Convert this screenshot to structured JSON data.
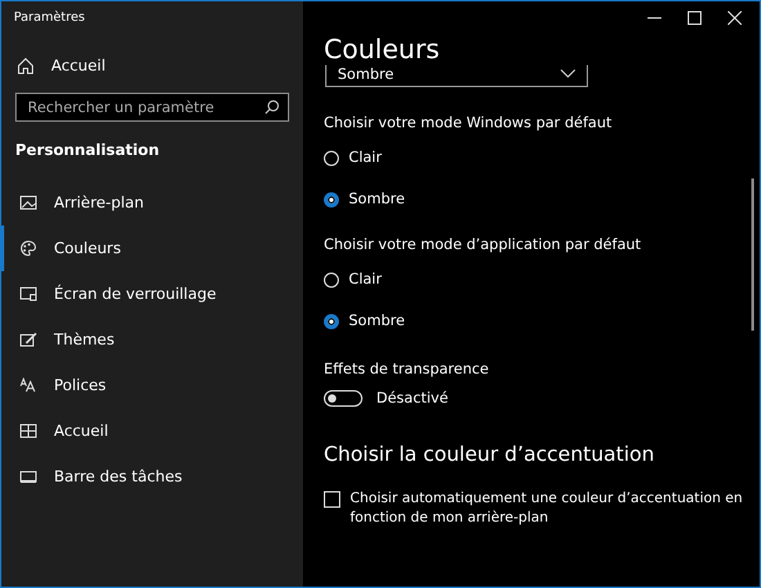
{
  "window": {
    "title": "Paramètres"
  },
  "sidebar": {
    "home": "Accueil",
    "search": {
      "placeholder": "Rechercher un paramètre"
    },
    "section": "Personnalisation",
    "items": [
      {
        "label": "Arrière-plan",
        "selected": false
      },
      {
        "label": "Couleurs",
        "selected": true
      },
      {
        "label": "Écran de verrouillage",
        "selected": false
      },
      {
        "label": "Thèmes",
        "selected": false
      },
      {
        "label": "Polices",
        "selected": false
      },
      {
        "label": "Accueil",
        "selected": false
      },
      {
        "label": "Barre des tâches",
        "selected": false
      }
    ]
  },
  "content": {
    "title": "Couleurs",
    "dropdown": {
      "value": "Sombre"
    },
    "groups": [
      {
        "label": "Choisir votre mode Windows par défaut",
        "options": [
          {
            "label": "Clair",
            "selected": false
          },
          {
            "label": "Sombre",
            "selected": true
          }
        ]
      },
      {
        "label": "Choisir votre mode d’application par défaut",
        "options": [
          {
            "label": "Clair",
            "selected": false
          },
          {
            "label": "Sombre",
            "selected": true
          }
        ]
      }
    ],
    "transparency": {
      "label": "Effets de transparence",
      "on": false,
      "state_text": "Désactivé"
    },
    "accent_heading": "Choisir la couleur d’accentuation",
    "auto_accent": {
      "label": "Choisir automatiquement une couleur d’accentuation en fonction de mon arrière-plan",
      "checked": false
    }
  }
}
